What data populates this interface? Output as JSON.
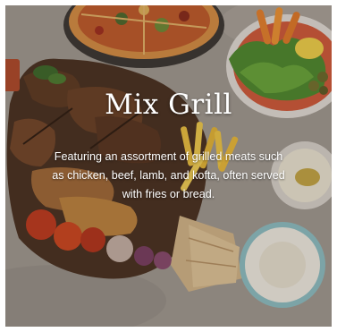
{
  "card": {
    "title": "Mix Grill",
    "description": "Featuring an assortment of grilled meats such as chicken, beef, lamb, and kofta, often served with fries or bread."
  }
}
